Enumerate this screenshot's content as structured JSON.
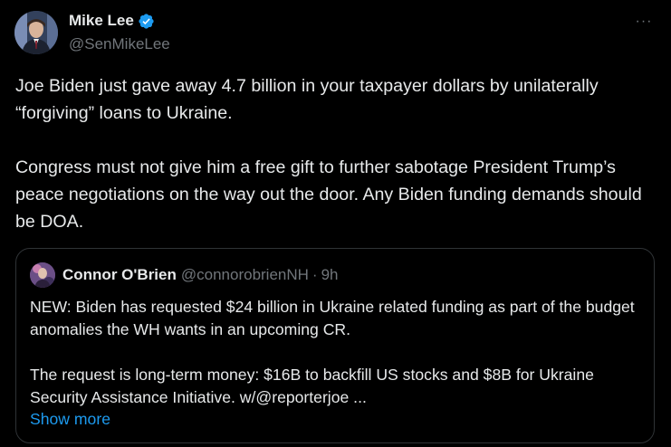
{
  "author": {
    "name": "Mike Lee",
    "handle": "@SenMikeLee",
    "verified_icon": "verified-badge-icon",
    "verified_color": "#1d9bf0"
  },
  "more_menu": {
    "icon": "more-horizontal-icon",
    "glyph": "···"
  },
  "tweet": {
    "paragraph_1": "Joe Biden just gave away 4.7 billion in your taxpayer dollars by unilaterally “forgiving” loans to Ukraine.",
    "paragraph_2": "Congress must not give him a free gift to further sabotage President Trump’s peace negotiations on the way out the door. Any Biden funding demands should be DOA."
  },
  "quoted_tweet": {
    "name": "Connor O'Brien",
    "handle": "@connorobrienNH",
    "separator": "·",
    "time": "9h",
    "paragraph_1": "NEW: Biden has requested $24 billion in Ukraine related funding as part of the budget anomalies the WH wants in an upcoming CR.",
    "paragraph_2": "The request is long-term money: $16B to backfill US stocks and $8B for Ukraine Security Assistance Initiative. w/@reporterjoe ...",
    "show_more": "Show more"
  },
  "colors": {
    "background": "#000000",
    "text": "#e7e9ea",
    "secondary_text": "#71767b",
    "link": "#1d9bf0",
    "border": "#2f3336"
  }
}
